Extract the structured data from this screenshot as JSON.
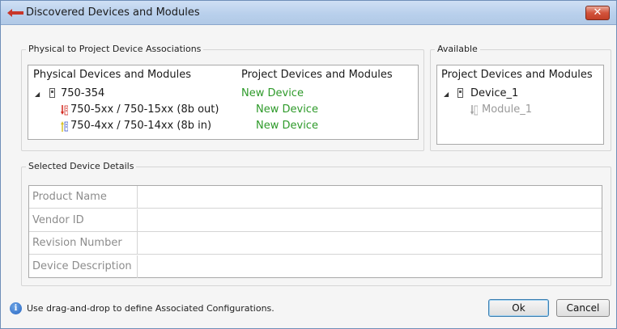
{
  "window": {
    "title": "Discovered Devices and Modules",
    "close_label": "✕"
  },
  "associations": {
    "group_label": "Physical to Project Device Associations",
    "col_physical": "Physical Devices and Modules",
    "col_project": "Project Devices and Modules",
    "rows": [
      {
        "physical": "750-354",
        "project": "New Device"
      },
      {
        "physical": "750-5xx / 750-15xx (8b out)",
        "project": "New Device"
      },
      {
        "physical": "750-4xx / 750-14xx (8b in)",
        "project": "New Device"
      }
    ]
  },
  "available": {
    "group_label": "Available",
    "col_project": "Project Devices and Modules",
    "device": "Device_1",
    "module": "Module_1"
  },
  "details": {
    "group_label": "Selected Device Details",
    "rows": [
      {
        "label": "Product Name",
        "value": ""
      },
      {
        "label": "Vendor ID",
        "value": ""
      },
      {
        "label": "Revision Number",
        "value": ""
      },
      {
        "label": "Device Description",
        "value": ""
      }
    ]
  },
  "footer": {
    "info_glyph": "i",
    "hint": "Use drag-and-drop to define Associated Configurations.",
    "ok_label": "Ok",
    "cancel_label": "Cancel"
  },
  "colors": {
    "assigned_text": "#2e9a2a",
    "unavailable_text": "#9a9a9a",
    "close_button": "#c23f27"
  }
}
